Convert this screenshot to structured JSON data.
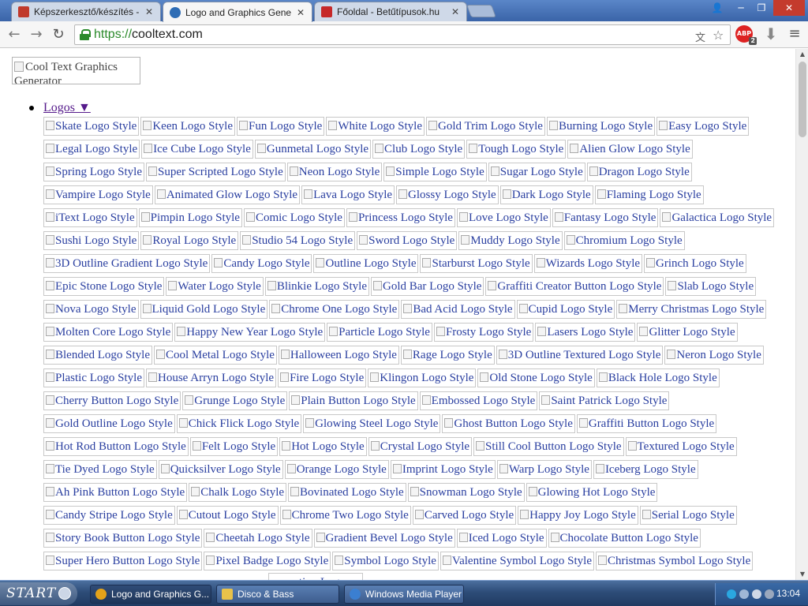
{
  "browser": {
    "tabs": [
      {
        "title": "Képszerkesztő/készítés - hlm",
        "active": false,
        "favicon_color": "#c0392b"
      },
      {
        "title": "Logo and Graphics Generator",
        "active": true,
        "favicon_color": "#2f6db5"
      },
      {
        "title": "Főoldal - Betűtípusok.hu",
        "active": false,
        "favicon_color": "#c62828"
      }
    ],
    "close_glyph": "✕",
    "url_scheme": "https://",
    "url_host": "cooltext.com",
    "adblock_label": "ABP",
    "adblock_count": "2",
    "window_buttons": {
      "user": "👤",
      "minimize": "─",
      "maximize": "❐",
      "close": "✕"
    }
  },
  "page": {
    "logo_alt": "Cool Text Graphics Generator",
    "menu_link": "Logos ▼",
    "rows": [
      [
        "Skate Logo Style",
        "Keen Logo Style",
        "Fun Logo Style",
        "White Logo Style",
        "Gold Trim Logo Style",
        "Burning Logo Style",
        "Easy Logo Style"
      ],
      [
        "Legal Logo Style",
        "Ice Cube Logo Style",
        "Gunmetal Logo Style",
        "Club Logo Style",
        "Tough Logo Style",
        "Alien Glow Logo Style"
      ],
      [
        "Spring Logo Style",
        "Super Scripted Logo Style",
        "Neon Logo Style",
        "Simple Logo Style",
        "Sugar Logo Style",
        "Dragon Logo Style"
      ],
      [
        "Vampire Logo Style",
        "Animated Glow Logo Style",
        "Lava Logo Style",
        "Glossy Logo Style",
        "Dark Logo Style",
        "Flaming Logo Style"
      ],
      [
        "iText Logo Style",
        "Pimpin Logo Style",
        "Comic Logo Style",
        "Princess Logo Style",
        "Love Logo Style",
        "Fantasy Logo Style",
        "Galactica Logo Style"
      ],
      [
        "Sushi Logo Style",
        "Royal Logo Style",
        "Studio 54 Logo Style",
        "Sword Logo Style",
        "Muddy Logo Style",
        "Chromium Logo Style"
      ],
      [
        "3D Outline Gradient Logo Style",
        "Candy Logo Style",
        "Outline Logo Style",
        "Starburst Logo Style",
        "Wizards Logo Style",
        "Grinch Logo Style"
      ],
      [
        "Epic Stone Logo Style",
        "Water Logo Style",
        "Blinkie Logo Style",
        "Gold Bar Logo Style",
        "Graffiti Creator Button Logo Style",
        "Slab Logo Style"
      ],
      [
        "Nova Logo Style",
        "Liquid Gold Logo Style",
        "Chrome One Logo Style",
        "Bad Acid Logo Style",
        "Cupid Logo Style",
        "Merry Christmas Logo Style"
      ],
      [
        "Molten Core Logo Style",
        "Happy New Year Logo Style",
        "Particle Logo Style",
        "Frosty Logo Style",
        "Lasers Logo Style",
        "Glitter Logo Style"
      ],
      [
        "Blended Logo Style",
        "Cool Metal Logo Style",
        "Halloween Logo Style",
        "Rage Logo Style",
        "3D Outline Textured Logo Style",
        "Neron Logo Style"
      ],
      [
        "Plastic Logo Style",
        "House Arryn Logo Style",
        "Fire Logo Style",
        "Klingon Logo Style",
        "Old Stone Logo Style",
        "Black Hole Logo Style"
      ],
      [
        "Cherry Button Logo Style",
        "Grunge Logo Style",
        "Plain Button Logo Style",
        "Embossed Logo Style",
        "Saint Patrick Logo Style"
      ],
      [
        "Gold Outline Logo Style",
        "Chick Flick Logo Style",
        "Glowing Steel Logo Style",
        "Ghost Button Logo Style",
        "Graffiti Button Logo Style"
      ],
      [
        "Hot Rod Button Logo Style",
        "Felt Logo Style",
        "Hot Logo Style",
        "Crystal Logo Style",
        "Still Cool Button Logo Style",
        "Textured Logo Style"
      ],
      [
        "Tie Dyed Logo Style",
        "Quicksilver Logo Style",
        "Orange Logo Style",
        "Imprint Logo Style",
        "Warp Logo Style",
        "Iceberg Logo Style"
      ],
      [
        "Ah Pink Button Logo Style",
        "Chalk Logo Style",
        "Bovinated Logo Style",
        "Snowman Logo Style",
        "Glowing Hot Logo Style"
      ],
      [
        "Candy Stripe Logo Style",
        "Cutout Logo Style",
        "Chrome Two Logo Style",
        "Carved Logo Style",
        "Happy Joy Logo Style",
        "Serial Logo Style"
      ],
      [
        "Story Book Button Logo Style",
        "Cheetah Logo Style",
        "Gradient Bevel Logo Style",
        "Iced Logo Style",
        "Chocolate Button Logo Style"
      ],
      [
        "Super Hero Button Logo Style",
        "Pixel Badge Logo Style",
        "Symbol Logo Style",
        "Valentine Symbol Logo Style",
        "Christmas Symbol Logo Style"
      ]
    ],
    "partial_item": "...ation Logo Style"
  },
  "taskbar": {
    "start_label": "START",
    "tasks": [
      {
        "title": "Logo and Graphics G...",
        "active": true,
        "icon_color": "#e3a21a"
      },
      {
        "title": "Disco & Bass",
        "active": false,
        "icon_color": "#e8c24a"
      },
      {
        "title": "Windows Media Player",
        "active": false,
        "icon_color": "#3b7fd1"
      }
    ],
    "clock": "13:04"
  }
}
